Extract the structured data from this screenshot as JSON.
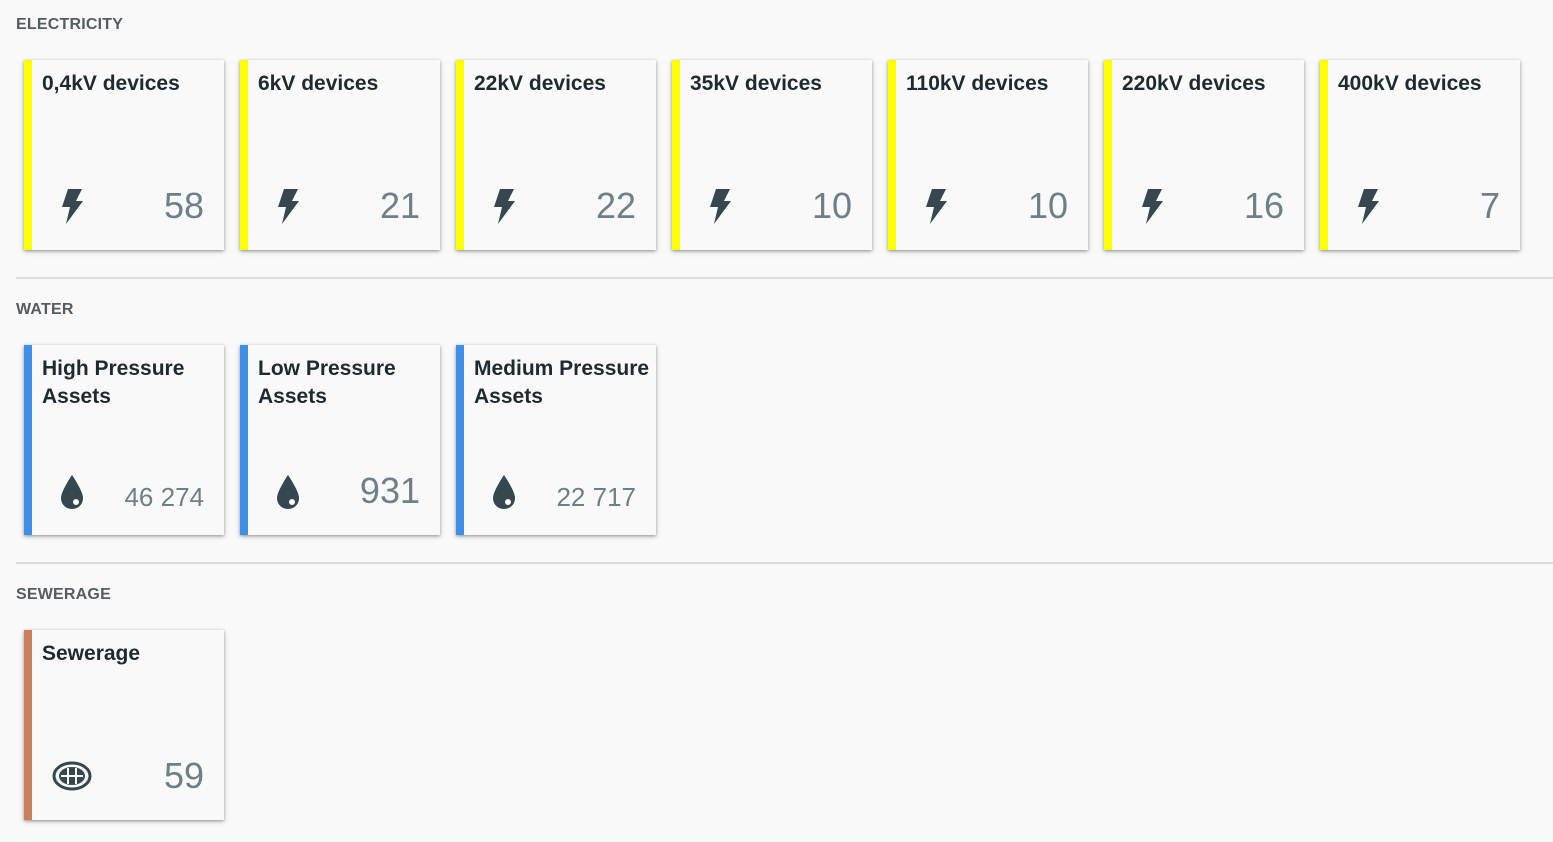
{
  "sections": {
    "electricity": {
      "title": "ELECTRICITY",
      "accent": "#ffff00",
      "cards": [
        {
          "label": "0,4kV devices",
          "value": "58",
          "icon": "lightning-bolt-icon"
        },
        {
          "label": "6kV devices",
          "value": "21",
          "icon": "lightning-bolt-icon"
        },
        {
          "label": "22kV devices",
          "value": "22",
          "icon": "lightning-bolt-icon"
        },
        {
          "label": "35kV devices",
          "value": "10",
          "icon": "lightning-bolt-icon"
        },
        {
          "label": "110kV devices",
          "value": "10",
          "icon": "lightning-bolt-icon"
        },
        {
          "label": "220kV devices",
          "value": "16",
          "icon": "lightning-bolt-icon"
        },
        {
          "label": "400kV devices",
          "value": "7",
          "icon": "lightning-bolt-icon"
        }
      ]
    },
    "water": {
      "title": "WATER",
      "accent": "#3f8ee8",
      "cards": [
        {
          "label": "High Pressure Assets",
          "value": "46 274",
          "icon": "water-drop-icon"
        },
        {
          "label": "Low Pressure Assets",
          "value": "931",
          "icon": "water-drop-icon"
        },
        {
          "label": "Medium Pressure Assets",
          "value": "22 717",
          "icon": "water-drop-icon"
        }
      ]
    },
    "sewerage": {
      "title": "SEWERAGE",
      "accent": "#c8805c",
      "cards": [
        {
          "label": "Sewerage",
          "value": "59",
          "icon": "manhole-cover-icon"
        }
      ]
    }
  }
}
